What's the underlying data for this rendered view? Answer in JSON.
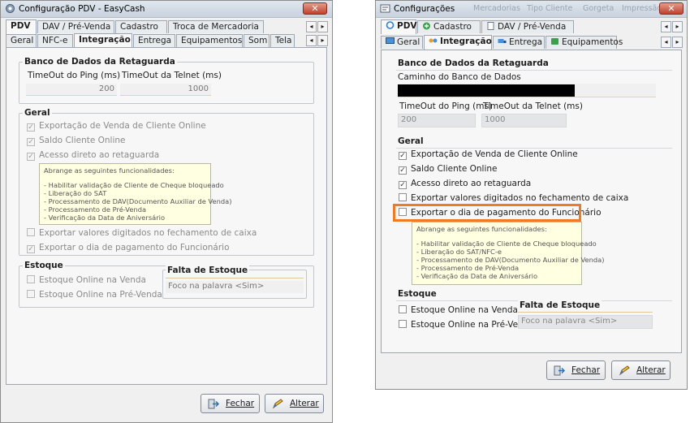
{
  "left": {
    "title": "Configuração PDV - EasyCash",
    "close": "✕",
    "main_tabs": [
      "PDV",
      "DAV / Pré-Venda",
      "Cadastro",
      "Troca de Mercadoria"
    ],
    "sub_tabs": [
      "Geral",
      "NFC-e",
      "Integração",
      "Entrega",
      "Equipamentos",
      "Som",
      "Tela"
    ],
    "arrow_left": "◂",
    "arrow_right": "▸",
    "banco": {
      "title": "Banco de Dados da Retaguarda",
      "ping_label": "TimeOut do Ping (ms)",
      "ping_value": "200",
      "telnet_label": "TimeOut da Telnet (ms)",
      "telnet_value": "1000"
    },
    "geral": {
      "title": "Geral",
      "items": [
        "Exportação de Venda de Cliente Online",
        "Saldo Cliente Online",
        "Acesso direto ao retaguarda"
      ],
      "items2": [
        "Exportar valores digitados no fechamento de caixa",
        "Exportar o dia de pagamento do Funcionário"
      ]
    },
    "tooltip": {
      "heading": "Abrange as seguintes funcionalidades:",
      "lines": [
        "- Habilitar validação de Cliente de Cheque bloqueado",
        "- Liberação do SAT",
        "- Processamento de DAV(Documento Auxiliar de Venda)",
        "- Processamento de Pré-Venda",
        "- Verificação da Data de Aniversário"
      ]
    },
    "estoque": {
      "title": "Estoque",
      "items": [
        "Estoque Online na Venda",
        "Estoque Online na Pré-Venda"
      ],
      "falta_title": "Falta de Estoque",
      "falta_value": "Foco na palavra <Sim>"
    },
    "buttons": {
      "fechar": "Fechar",
      "alterar": "Alterar"
    }
  },
  "right": {
    "title": "Configurações",
    "ghost_menu": [
      "Mercadorias",
      "Tipo Cliente",
      "Gorgeta",
      "Impressão"
    ],
    "close": "✕",
    "main_tabs": [
      "PDV",
      "Cadastro",
      "DAV / Pré-Venda"
    ],
    "sub_tabs": [
      "Geral",
      "Integração",
      "Entrega",
      "Equipamentos"
    ],
    "arrow_left": "◂",
    "arrow_right": "▸",
    "banco": {
      "title": "Banco de Dados da Retaguarda",
      "caminho_label": "Caminho do Banco de Dados",
      "ping_label": "TimeOut do Ping (ms)",
      "ping_value": "200",
      "telnet_label": "TimeOut da Telnet (ms)",
      "telnet_value": "1000"
    },
    "geral": {
      "title": "Geral",
      "items": [
        "Exportação de Venda de Cliente Online",
        "Saldo Cliente Online",
        "Acesso direto ao retaguarda",
        "Exportar valores digitados no fechamento de caixa",
        "Exportar o dia de pagamento do Funcionário"
      ]
    },
    "tooltip": {
      "heading": "Abrange as seguintes funcionalidades:",
      "lines": [
        "- Habilitar validação de Cliente de Cheque bloqueado",
        "- Liberação do SAT/NFC-e",
        "- Processamento de DAV(Documento Auxiliar de Venda)",
        "- Processamento de Pré-Venda",
        "- Verificação da Data de Aniversário"
      ]
    },
    "estoque": {
      "title": "Estoque",
      "items": [
        "Estoque Online na Venda",
        "Estoque Online na Pré-Venda"
      ],
      "falta_title": "Falta de Estoque",
      "falta_value": "Foco na palavra <Sim>"
    },
    "buttons": {
      "fechar": "Fechar",
      "alterar": "Alterar"
    }
  },
  "checkmark": "✓",
  "colors": {
    "highlight": "#f07b27",
    "tooltip_bg": "#ffffe1"
  }
}
